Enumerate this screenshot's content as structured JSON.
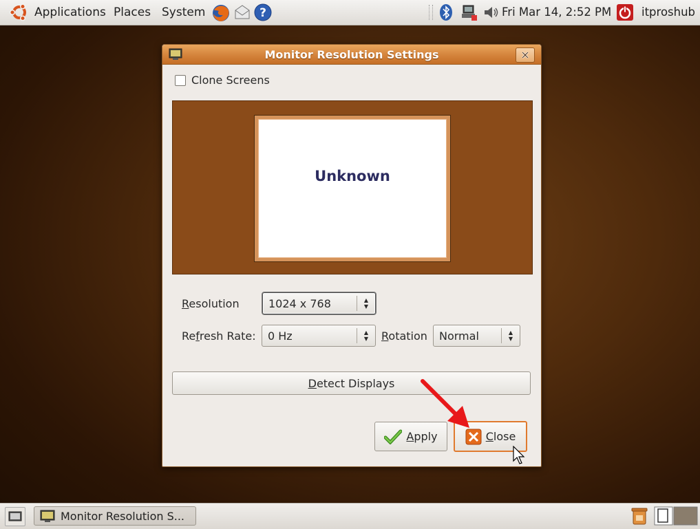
{
  "top_panel": {
    "menus": [
      "Applications",
      "Places",
      "System"
    ],
    "clock": "Fri Mar 14,  2:52 PM",
    "user": "itproshub"
  },
  "dialog": {
    "title": "Monitor Resolution Settings",
    "clone_screens_label": "Clone Screens",
    "clone_screens_checked": false,
    "monitor_label": "Unknown",
    "resolution_label": "Resolution",
    "resolution_value": "1024 x 768",
    "refresh_label": "Refresh Rate:",
    "refresh_value": "0 Hz",
    "rotation_label": "Rotation",
    "rotation_value": "Normal",
    "detect_label": "Detect Displays",
    "apply_label": "Apply",
    "close_label": "Close"
  },
  "taskbar": {
    "window_button_label": "Monitor Resolution S..."
  },
  "colors": {
    "title_bar": "#d4833b",
    "monitor_bg": "#8a4b19",
    "annotation_arrow": "#e8181a"
  }
}
